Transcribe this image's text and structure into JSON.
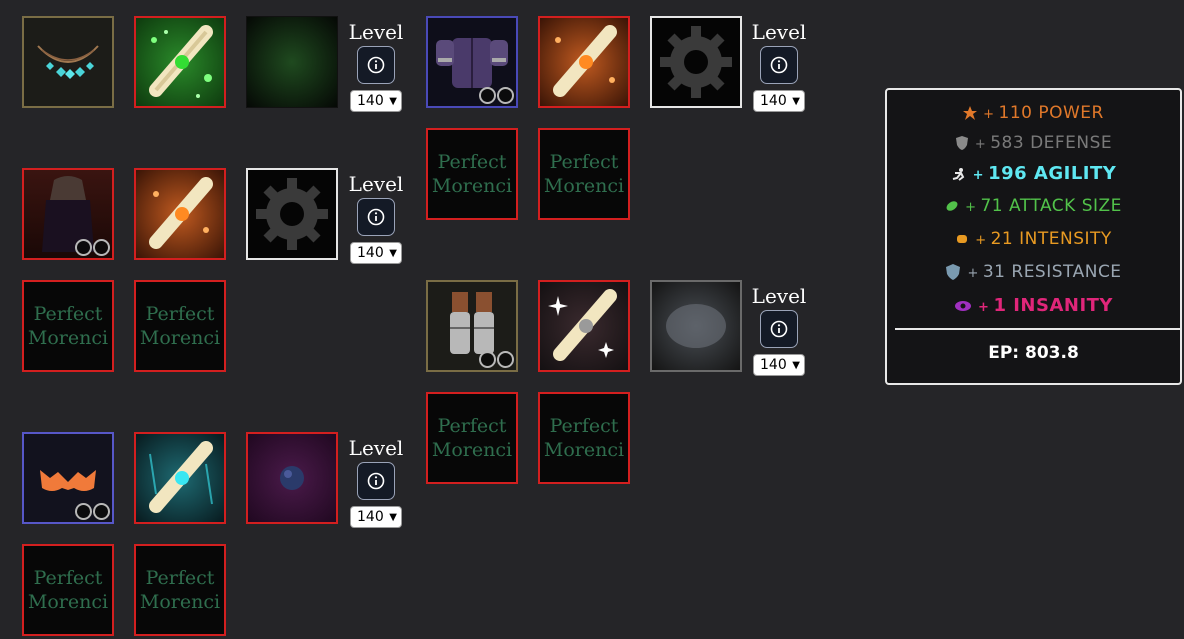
{
  "builds": [
    {
      "level_label": "Level",
      "level_value": "140"
    },
    {
      "level_label": "Level",
      "level_value": "140"
    },
    {
      "level_label": "Level",
      "level_value": "140"
    },
    {
      "level_label": "Level",
      "level_value": "140"
    },
    {
      "level_label": "Level",
      "level_value": "140"
    }
  ],
  "placeholder": {
    "line1": "Perfect",
    "line2": "Morenci"
  },
  "stats": [
    {
      "plus": "+",
      "value": "110 POWER",
      "color": "#e0782a",
      "icon": "power-icon"
    },
    {
      "plus": "+",
      "value": "583 DEFENSE",
      "color": "#7a7a7a",
      "icon": "defense-shield-icon"
    },
    {
      "plus": "+",
      "value": "196 AGILITY",
      "color": "#5fe8f2",
      "icon": "agility-icon"
    },
    {
      "plus": "+",
      "value": "71 ATTACK SIZE",
      "color": "#52c24a",
      "icon": "attack-size-icon"
    },
    {
      "plus": "+",
      "value": "21 INTENSITY",
      "color": "#e89a22",
      "icon": "intensity-icon"
    },
    {
      "plus": "+",
      "value": "31 RESISTANCE",
      "color": "#9aa6b2",
      "icon": "resistance-icon"
    },
    {
      "plus": "+",
      "value": "1 INSANITY",
      "color": "#e0267a",
      "icon": "insanity-eye-icon"
    }
  ],
  "ep_label": "EP: 803.8"
}
